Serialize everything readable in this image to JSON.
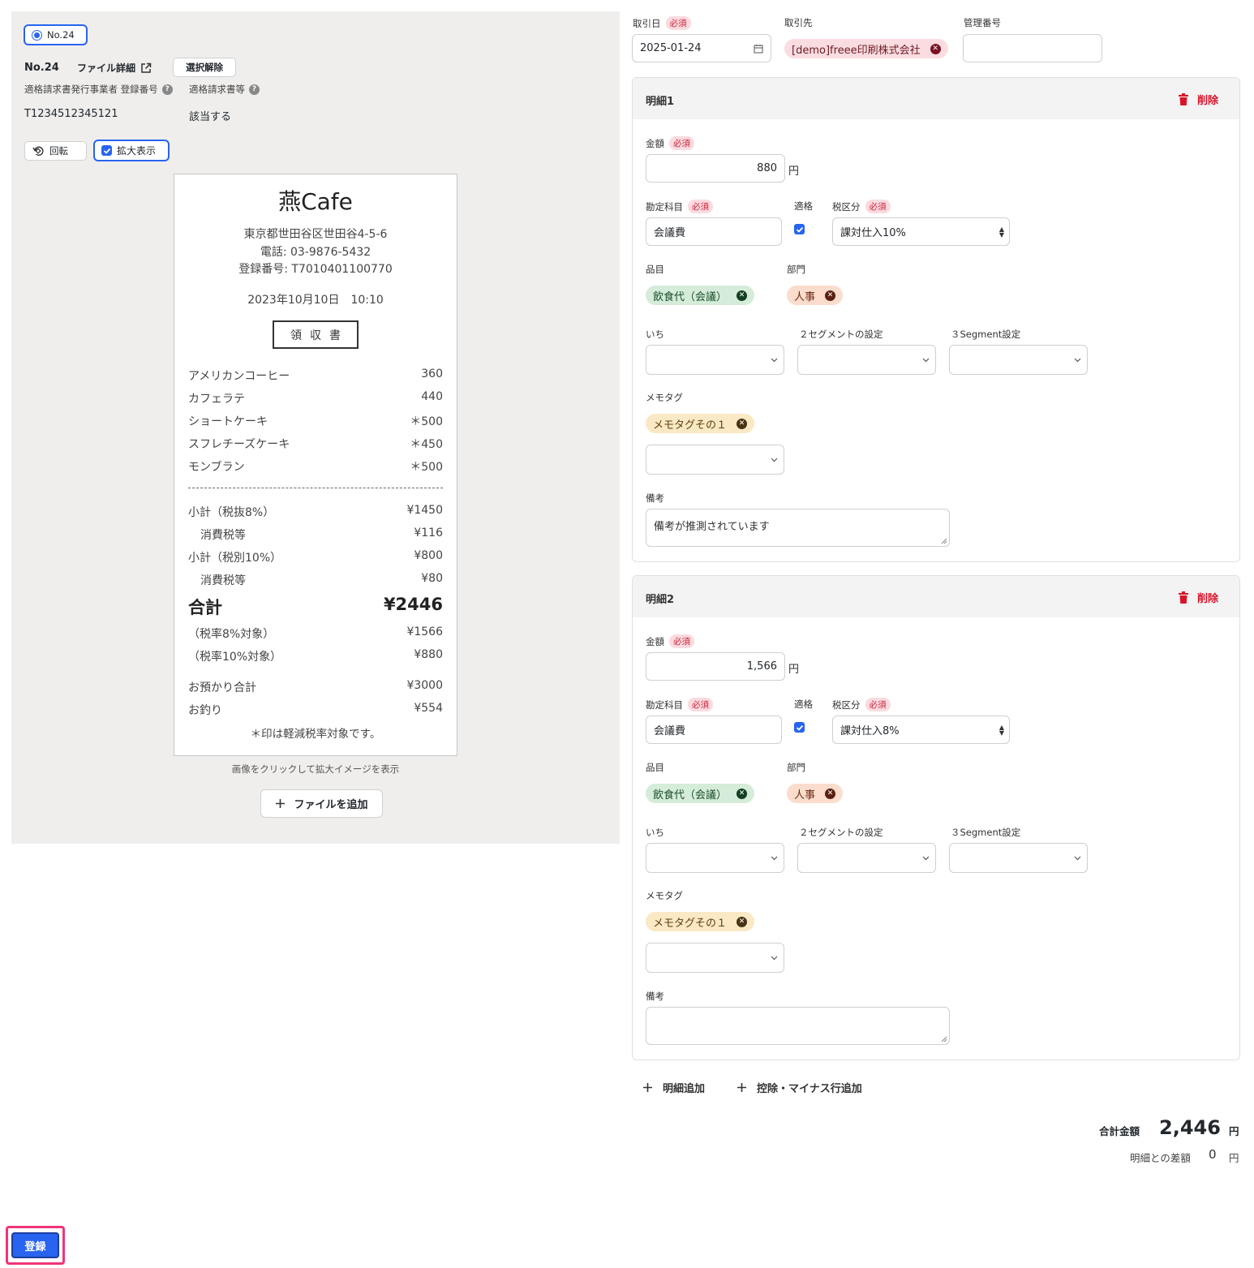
{
  "left": {
    "file_chip": "No.24",
    "file_no": "No.24",
    "file_detail": "ファイル詳細",
    "deselect": "選択解除",
    "issuer_label": "適格請求書発行事業者 登録番号",
    "invoice_label": "適格請求書等",
    "issuer_value": "T1234512345121",
    "invoice_value": "該当する",
    "rotate": "回転",
    "zoom": "拡大表示",
    "image_hint": "画像をクリックして拡大イメージを表示",
    "add_file": "ファイルを追加"
  },
  "receipt": {
    "shop": "燕Cafe",
    "address": "東京都世田谷区世田谷4-5-6",
    "phone": "電話: 03-9876-5432",
    "reg_no": "登録番号: T7010401100770",
    "datetime": "2023年10月10日　10:10",
    "doc_title": "領収書",
    "items": [
      {
        "name": "アメリカンコーヒー",
        "price": "360"
      },
      {
        "name": "カフェラテ",
        "price": "440"
      },
      {
        "name": "ショートケーキ",
        "price": "＊500"
      },
      {
        "name": "スフレチーズケーキ",
        "price": "＊450"
      },
      {
        "name": "モンブラン",
        "price": "＊500"
      }
    ],
    "subtotal8_label": "小計（税抜8%）",
    "subtotal8": "¥1450",
    "tax8_label": "消費税等",
    "tax8": "¥116",
    "subtotal10_label": "小計（税別10%）",
    "subtotal10": "¥800",
    "tax10_label": "消費税等",
    "tax10": "¥80",
    "total_label": "合計",
    "total": "¥2446",
    "rate8_label": "（税率8%対象）",
    "rate8": "¥1566",
    "rate10_label": "（税率10%対象）",
    "rate10": "¥880",
    "deposit_label": "お預かり合計",
    "deposit": "¥3000",
    "change_label": "お釣り",
    "change": "¥554",
    "note": "＊印は軽減税率対象です。"
  },
  "header": {
    "date_label": "取引日",
    "required": "必須",
    "date_value": "2025-01-24",
    "partner_label": "取引先",
    "partner_value": "[demo]freee印刷株式会社",
    "manage_label": "管理番号"
  },
  "labels": {
    "amount": "金額",
    "account": "勘定科目",
    "qualified": "適格",
    "tax": "税区分",
    "item": "品目",
    "dept": "部門",
    "seg1": "いち",
    "seg2": "２セグメントの設定",
    "seg3": "３Segment設定",
    "memo": "メモタグ",
    "remarks": "備考",
    "yen": "円",
    "delete": "削除"
  },
  "lines": [
    {
      "title": "明細1",
      "amount": "880",
      "account": "会議費",
      "tax": "課対仕入10%",
      "item_tag": "飲食代（会議）",
      "dept_tag": "人事",
      "memo_tag": "メモタグその１",
      "remarks": "備考が推測されています"
    },
    {
      "title": "明細2",
      "amount": "1,566",
      "account": "会議費",
      "tax": "課対仕入8%",
      "item_tag": "飲食代（会議）",
      "dept_tag": "人事",
      "memo_tag": "メモタグその１",
      "remarks": ""
    }
  ],
  "footer": {
    "add_line": "明細追加",
    "add_minus": "控除・マイナス行追加",
    "total_label": "合計金額",
    "total_value": "2,446",
    "total_unit": "円",
    "diff_label": "明細との差額",
    "diff_value": "0",
    "diff_unit": "円",
    "submit": "登録"
  },
  "colors": {
    "accent": "#2864f0",
    "danger": "#d8142a",
    "highlight": "#f0347a"
  }
}
